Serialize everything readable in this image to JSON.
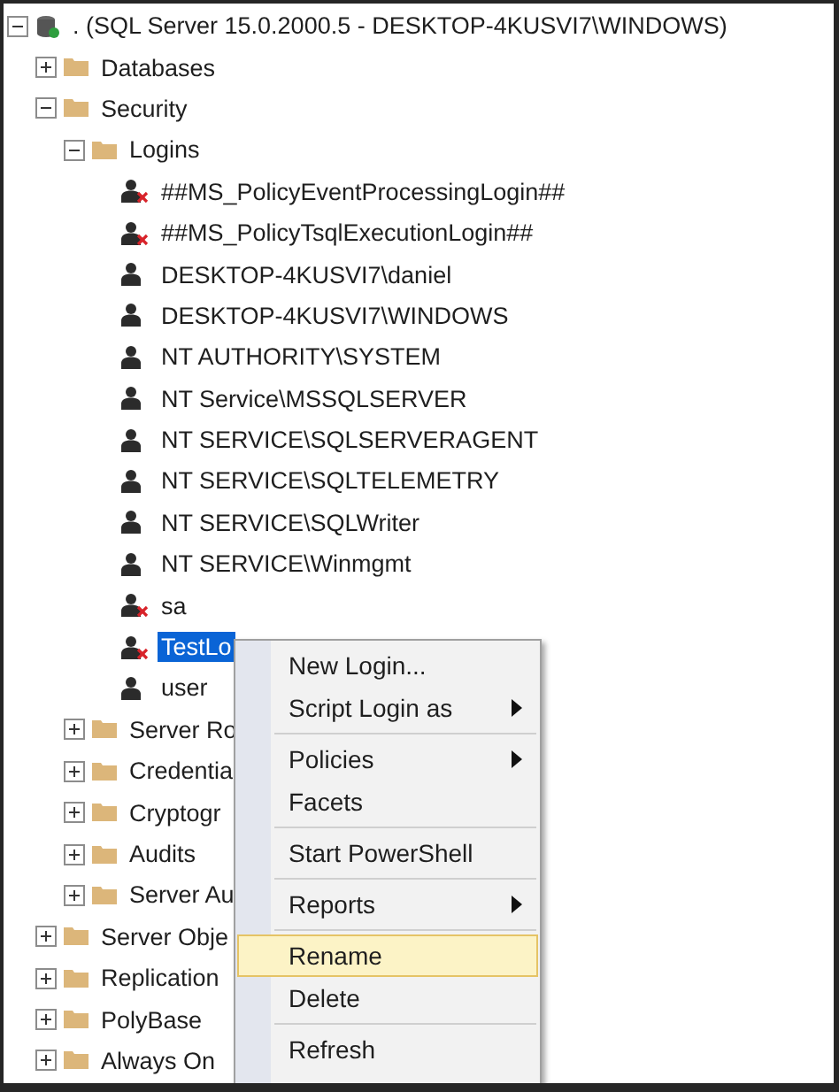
{
  "tree": [
    {
      "kind": "server",
      "label": ". (SQL Server 15.0.2000.5 - DESKTOP-4KUSVI7\\WINDOWS)",
      "expanded": true,
      "children": [
        {
          "kind": "folder",
          "label": "Databases",
          "expanded": false
        },
        {
          "kind": "folder",
          "label": "Security",
          "expanded": true,
          "children": [
            {
              "kind": "folder",
              "label": "Logins",
              "expanded": true,
              "children": [
                {
                  "kind": "login",
                  "label": "##MS_PolicyEventProcessingLogin##",
                  "disabled": true,
                  "selected": false
                },
                {
                  "kind": "login",
                  "label": "##MS_PolicyTsqlExecutionLogin##",
                  "disabled": true,
                  "selected": false
                },
                {
                  "kind": "login",
                  "label": "DESKTOP-4KUSVI7\\daniel",
                  "disabled": false,
                  "selected": false
                },
                {
                  "kind": "login",
                  "label": "DESKTOP-4KUSVI7\\WINDOWS",
                  "disabled": false,
                  "selected": false
                },
                {
                  "kind": "login",
                  "label": "NT AUTHORITY\\SYSTEM",
                  "disabled": false,
                  "selected": false
                },
                {
                  "kind": "login",
                  "label": "NT Service\\MSSQLSERVER",
                  "disabled": false,
                  "selected": false
                },
                {
                  "kind": "login",
                  "label": "NT SERVICE\\SQLSERVERAGENT",
                  "disabled": false,
                  "selected": false
                },
                {
                  "kind": "login",
                  "label": "NT SERVICE\\SQLTELEMETRY",
                  "disabled": false,
                  "selected": false
                },
                {
                  "kind": "login",
                  "label": "NT SERVICE\\SQLWriter",
                  "disabled": false,
                  "selected": false
                },
                {
                  "kind": "login",
                  "label": "NT SERVICE\\Winmgmt",
                  "disabled": false,
                  "selected": false
                },
                {
                  "kind": "login",
                  "label": "sa",
                  "disabled": true,
                  "selected": false
                },
                {
                  "kind": "login",
                  "label": "TestLo",
                  "disabled": true,
                  "selected": true
                },
                {
                  "kind": "login",
                  "label": "user",
                  "disabled": false,
                  "selected": false
                }
              ]
            },
            {
              "kind": "folder",
              "label": "Server Ro",
              "expanded": false
            },
            {
              "kind": "folder",
              "label": "Credentia",
              "expanded": false
            },
            {
              "kind": "folder",
              "label": "Cryptogr",
              "expanded": false
            },
            {
              "kind": "folder",
              "label": "Audits",
              "expanded": false
            },
            {
              "kind": "folder",
              "label": "Server Au",
              "expanded": false
            }
          ]
        },
        {
          "kind": "folder",
          "label": "Server Obje",
          "expanded": false
        },
        {
          "kind": "folder",
          "label": "Replication",
          "expanded": false
        },
        {
          "kind": "folder",
          "label": "PolyBase",
          "expanded": false
        },
        {
          "kind": "folder",
          "label": "Always On",
          "expanded": false
        }
      ]
    }
  ],
  "context_menu": {
    "items": [
      {
        "kind": "item",
        "label": "New Login...",
        "submenu": false,
        "selected": false
      },
      {
        "kind": "item",
        "label": "Script Login as",
        "submenu": true,
        "selected": false
      },
      {
        "kind": "separator"
      },
      {
        "kind": "item",
        "label": "Policies",
        "submenu": true,
        "selected": false
      },
      {
        "kind": "item",
        "label": "Facets",
        "submenu": false,
        "selected": false
      },
      {
        "kind": "separator"
      },
      {
        "kind": "item",
        "label": "Start PowerShell",
        "submenu": false,
        "selected": false
      },
      {
        "kind": "separator"
      },
      {
        "kind": "item",
        "label": "Reports",
        "submenu": true,
        "selected": false
      },
      {
        "kind": "separator"
      },
      {
        "kind": "item",
        "label": "Rename",
        "submenu": false,
        "selected": true
      },
      {
        "kind": "item",
        "label": "Delete",
        "submenu": false,
        "selected": false
      },
      {
        "kind": "separator"
      },
      {
        "kind": "item",
        "label": "Refresh",
        "submenu": false,
        "selected": false
      }
    ]
  }
}
